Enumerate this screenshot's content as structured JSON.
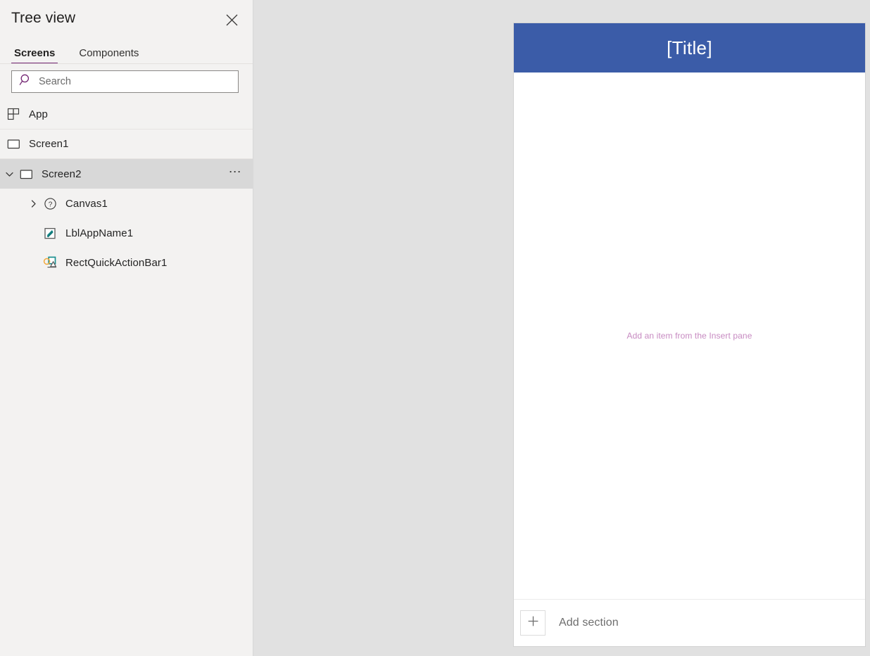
{
  "panel": {
    "title": "Tree view",
    "close_icon": "close-icon",
    "tabs": [
      {
        "label": "Screens",
        "active": true
      },
      {
        "label": "Components",
        "active": false
      }
    ],
    "search": {
      "placeholder": "Search",
      "value": "",
      "icon": "search-icon"
    },
    "tree": [
      {
        "label": "App",
        "icon": "app-grid-icon",
        "indent": 0,
        "chevron": "none",
        "selected": false,
        "ellipsis": false
      },
      {
        "label": "Screen1",
        "icon": "screen-icon",
        "indent": 0,
        "chevron": "none",
        "selected": false,
        "ellipsis": false
      },
      {
        "label": "Screen2",
        "icon": "screen-icon",
        "indent": 0,
        "chevron": "down",
        "selected": true,
        "ellipsis": true
      },
      {
        "label": "Canvas1",
        "icon": "question-circle-icon",
        "indent": 1,
        "chevron": "right",
        "selected": false,
        "ellipsis": false
      },
      {
        "label": "LblAppName1",
        "icon": "label-pencil-icon",
        "indent": 1,
        "chevron": "none",
        "selected": false,
        "ellipsis": false
      },
      {
        "label": "RectQuickActionBar1",
        "icon": "shapes-icon",
        "indent": 1,
        "chevron": "none",
        "selected": false,
        "ellipsis": false
      }
    ]
  },
  "canvas": {
    "title": "[Title]",
    "placeholder": "Add an item from the Insert pane",
    "add_section_label": "Add section",
    "add_section_icon": "plus-icon"
  },
  "colors": {
    "accent_purple": "#742774",
    "title_bar_blue": "#3b5ca8",
    "placeholder_pink": "#c78ac1",
    "sidebar_bg": "#f3f2f1",
    "workspace_bg": "#e1e1e1",
    "selected_row": "#d8d8d8"
  }
}
